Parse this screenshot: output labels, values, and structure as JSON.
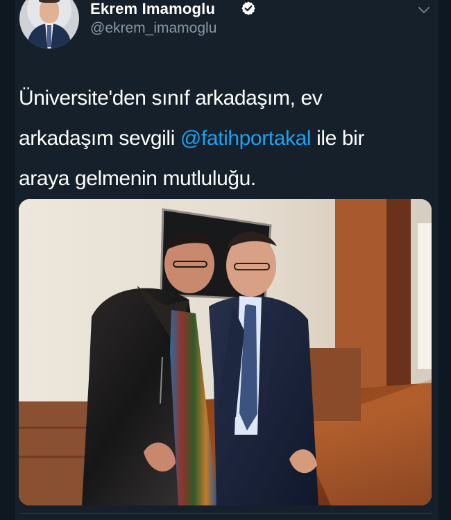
{
  "tweet": {
    "display_name": "Ekrem Imamoglu",
    "handle": "@ekrem_imamoglu",
    "text_line1": "Üniversite'den sınıf arkadaşım, ev",
    "text_line2_before": "arkadaşım sevgili ",
    "mention": "@fatihportakal",
    "text_line2_after": " ile bir",
    "text_line3": "araya gelmenin mutluluğu."
  },
  "icons": {
    "verified": "verified-badge-icon",
    "menu": "chevron-down-icon",
    "avatar": "profile-avatar"
  },
  "colors": {
    "background": "#15202b",
    "text": "#ffffff",
    "secondary": "#8899a6",
    "accent": "#1da1f2"
  }
}
